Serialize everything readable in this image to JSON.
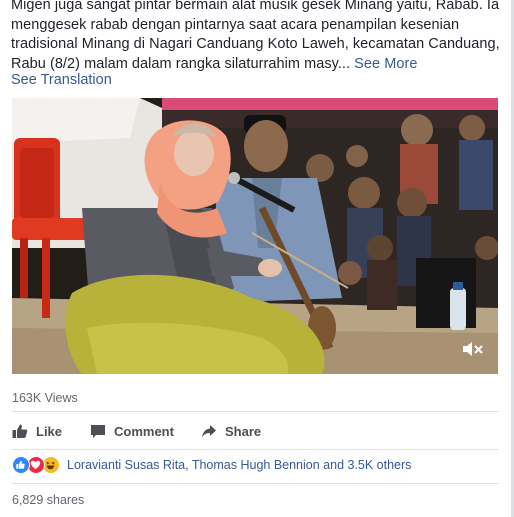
{
  "post": {
    "caption_lines": [
      "Migen juga sangat pintar bermain alat musik gesek Minang yaitu, Rabab. Ia",
      "menggesek rabab dengan pintarnya saat acara penampilan kesenian",
      "tradisional Minang di Nagari Canduang Koto Laweh, kecamatan Canduang,",
      "Rabu (8/2) malam dalam rangka silaturrahim masy..."
    ],
    "see_more": "See More",
    "see_translation": "See Translation"
  },
  "video": {
    "views": "163K Views",
    "mute_icon": "speaker-muted-icon"
  },
  "actions": {
    "like": "Like",
    "comment": "Comment",
    "share": "Share"
  },
  "reactions": {
    "icons": [
      "like-reaction-icon",
      "love-reaction-icon",
      "haha-reaction-icon"
    ],
    "text": "Loravianti Susas Rita, Thomas Hugh Bennion and 3.5K others"
  },
  "shares": "6,829 shares",
  "colors": {
    "link": "#385898",
    "muted": "#606770",
    "action": "#4b4f56",
    "like_blue": "#2d88ff",
    "love_red": "#f0284a",
    "haha_yellow": "#f7b928"
  }
}
